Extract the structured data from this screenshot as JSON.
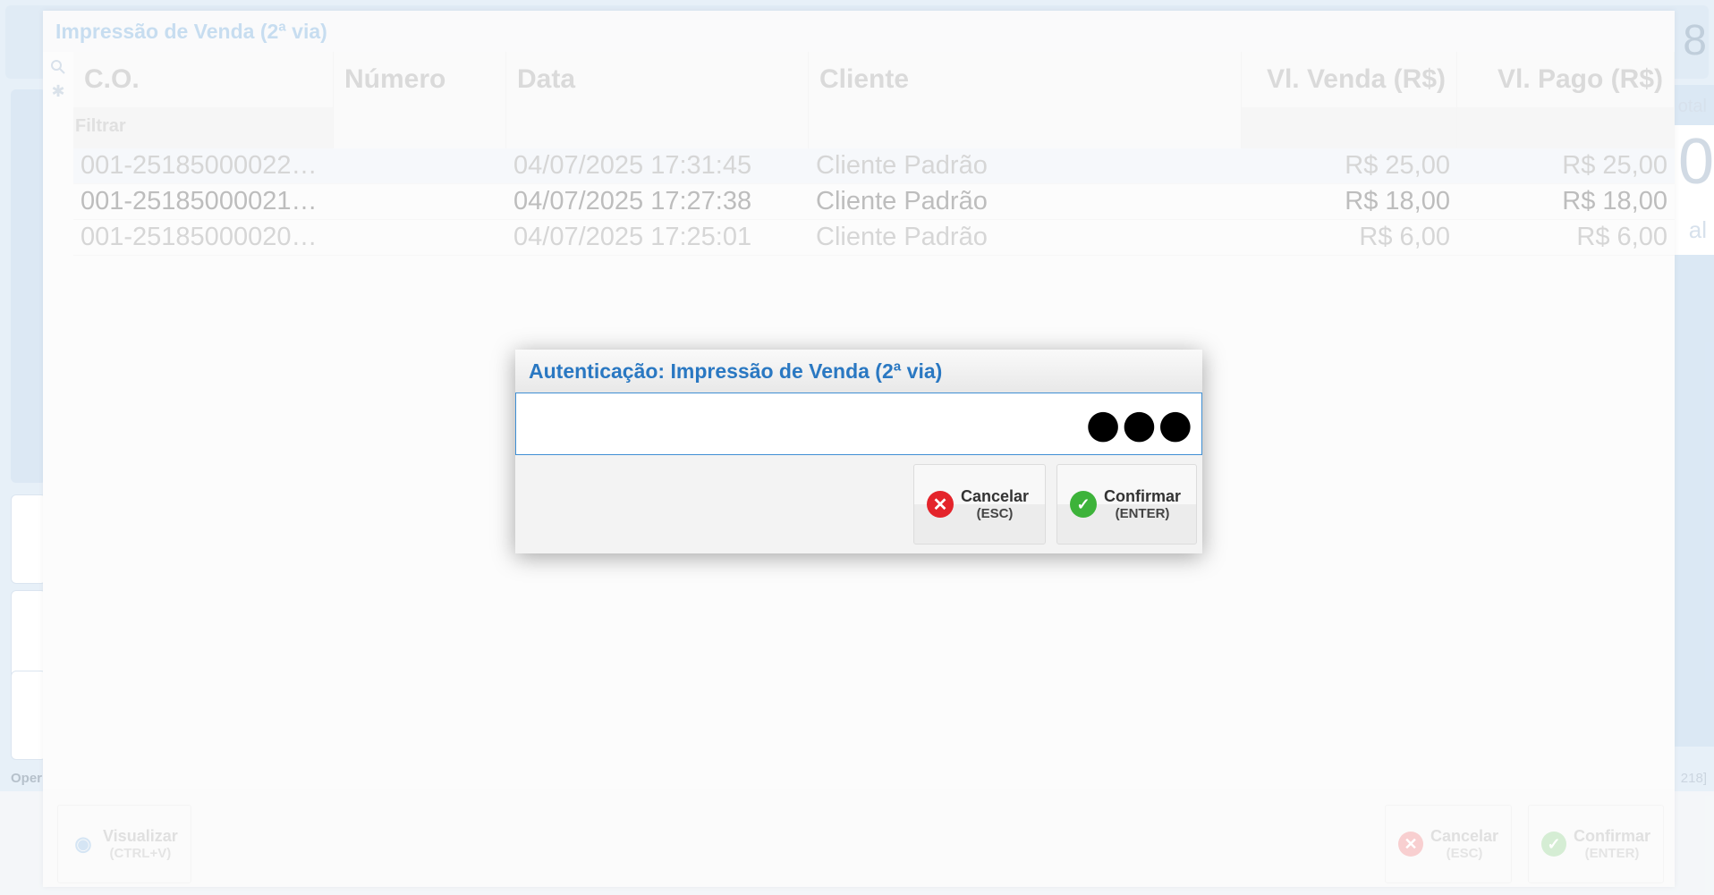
{
  "background_app": {
    "right_top_digit": "8",
    "right_label_top": "otal",
    "right_big_digit": "0",
    "right_label_bottom": "al",
    "status_left": "Oper",
    "status_right": "218]"
  },
  "window": {
    "title": "Impressão de Venda (2ª via)",
    "columns": [
      "C.O.",
      "Número",
      "Data",
      "Cliente",
      "Vl. Venda (R$)",
      "Vl. Pago (R$)"
    ],
    "filter_placeholder": "Filtrar",
    "rows": [
      {
        "co": "001-25185000022…",
        "numero": "",
        "data": "04/07/2025 17:31:45",
        "cliente": "Cliente Padrão",
        "venda": "R$ 25,00",
        "pago": "R$ 25,00"
      },
      {
        "co": "001-25185000021…",
        "numero": "",
        "data": "04/07/2025 17:27:38",
        "cliente": "Cliente Padrão",
        "venda": "R$ 18,00",
        "pago": "R$ 18,00"
      },
      {
        "co": "001-25185000020…",
        "numero": "",
        "data": "04/07/2025 17:25:01",
        "cliente": "Cliente Padrão",
        "venda": "R$ 6,00",
        "pago": "R$ 6,00"
      }
    ],
    "footer": {
      "view_label": "Visualizar",
      "view_shortcut": "(CTRL+V)",
      "cancel_label": "Cancelar",
      "cancel_shortcut": "(ESC)",
      "confirm_label": "Confirmar",
      "confirm_shortcut": "(ENTER)"
    }
  },
  "dialog": {
    "title": "Autenticação: Impressão de Venda (2ª via)",
    "password_value": "●●●",
    "cancel_label": "Cancelar",
    "cancel_shortcut": "(ESC)",
    "confirm_label": "Confirmar",
    "confirm_shortcut": "(ENTER)"
  },
  "icons": {
    "eye": "eye-icon",
    "search": "search-icon",
    "gear": "gear-icon",
    "cancel": "close-circle-icon",
    "confirm": "check-circle-icon"
  },
  "colors": {
    "accent": "#2a78c2",
    "cancel": "#e4242b",
    "confirm": "#3db33a"
  }
}
